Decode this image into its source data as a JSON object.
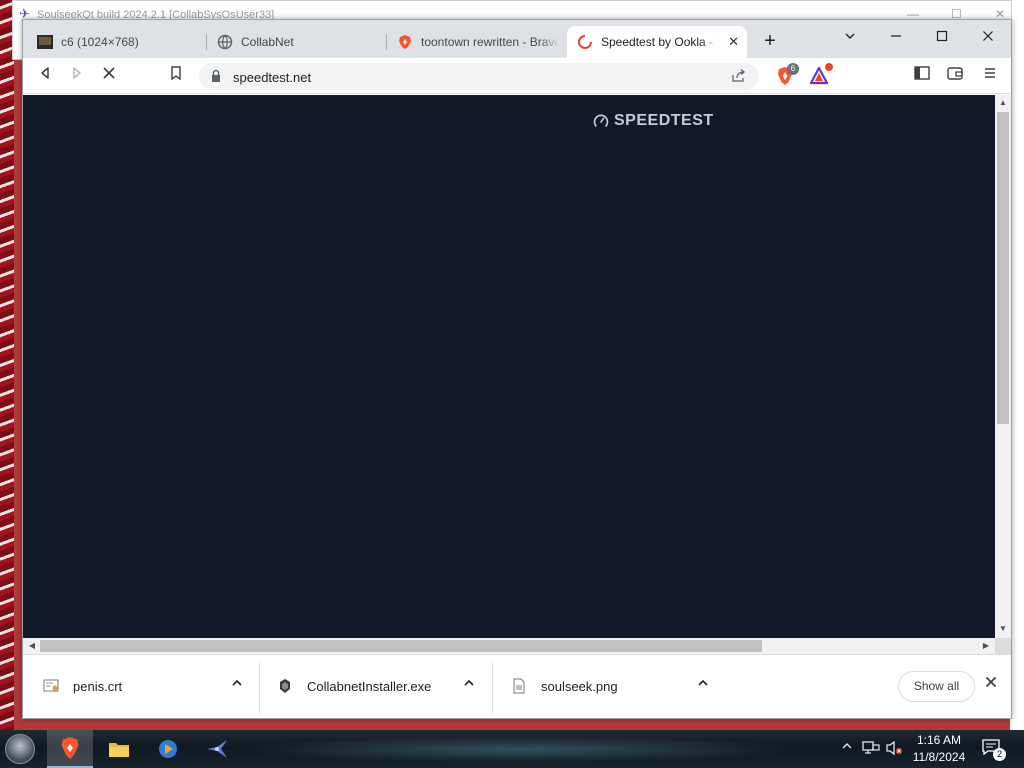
{
  "background_window": {
    "title": "SoulseekQt build 2024.2.1 [CollabSysOsUser33]"
  },
  "browser": {
    "tabs": [
      {
        "label": "c6 (1024×768)"
      },
      {
        "label": "CollabNet"
      },
      {
        "label": "toontown rewritten - Brave"
      },
      {
        "label": "Speedtest by Ookla - T"
      }
    ],
    "address": "speedtest.net",
    "extensions": {
      "brave_shields_count": "6",
      "rewards_badge": ""
    }
  },
  "page": {
    "brand_text": "SPEEDTEST"
  },
  "downloads": {
    "items": [
      {
        "name": "penis.crt"
      },
      {
        "name": "CollabnetInstaller.exe"
      },
      {
        "name": "soulseek.png"
      }
    ],
    "show_all_label": "Show all"
  },
  "taskbar": {
    "time": "1:16 AM",
    "date": "11/8/2024",
    "notification_count": "2"
  },
  "colors": {
    "page_background": "#121827",
    "tabstrip": "#dee1e6",
    "brave_orange": "#fb542b"
  }
}
